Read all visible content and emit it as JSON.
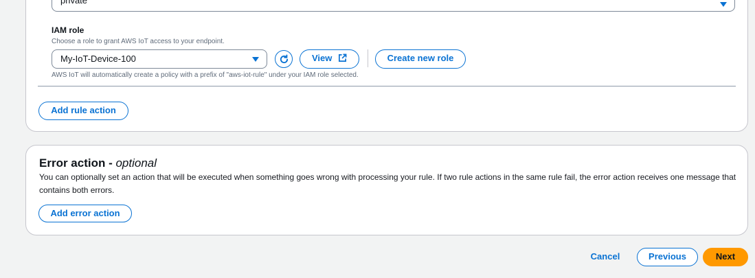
{
  "rule_action": {
    "top_select_value": "private",
    "iam_role": {
      "label": "IAM role",
      "description": "Choose a role to grant AWS IoT access to your endpoint.",
      "selected_value": "My-IoT-Device-100",
      "refresh_icon": "refresh-icon",
      "view_label": "View",
      "view_icon": "external-link-icon",
      "create_label": "Create new role",
      "help_text": "AWS IoT will automatically create a policy with a prefix of \"aws-iot-rule\" under your IAM role selected."
    },
    "add_rule_action_label": "Add rule action"
  },
  "error_action": {
    "title": "Error action - ",
    "title_optional": "optional",
    "description": "You can optionally set an action that will be executed when something goes wrong with processing your rule. If two rule actions in the same rule fail, the error action receives one message that contains both errors.",
    "add_error_action_label": "Add error action"
  },
  "footer": {
    "cancel_label": "Cancel",
    "previous_label": "Previous",
    "next_label": "Next"
  },
  "colors": {
    "accent": "#0972d3",
    "primary_button": "#ff9900",
    "page_background": "#f2f3f3"
  }
}
